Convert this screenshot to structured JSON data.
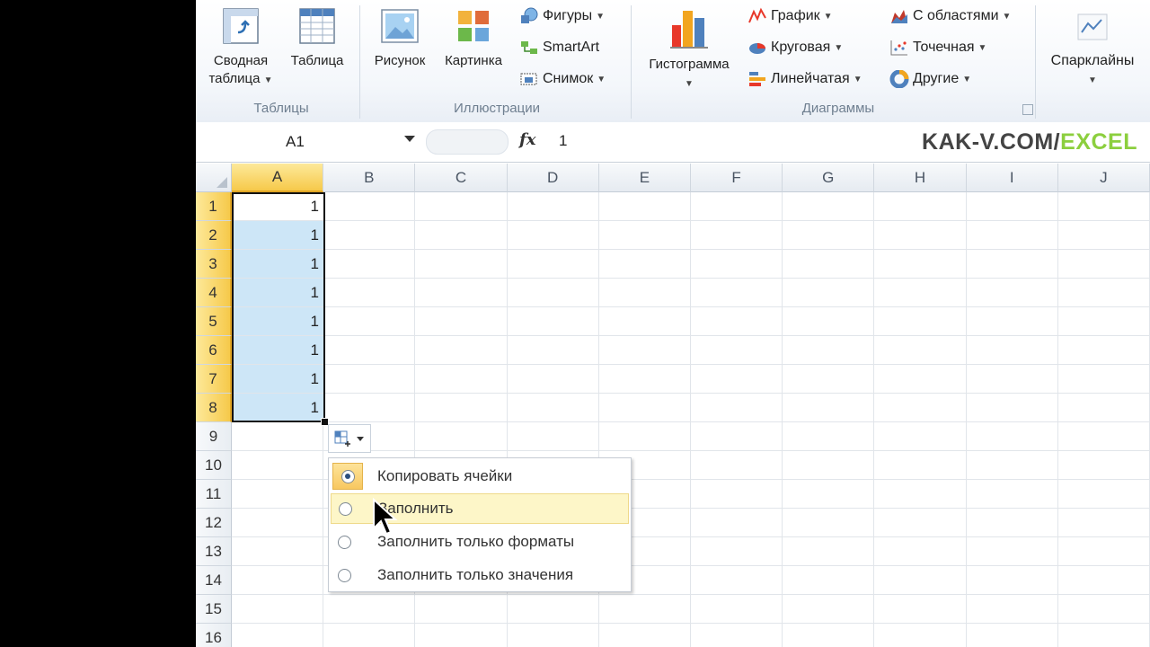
{
  "ribbon": {
    "groups": {
      "tables": "Таблицы",
      "illustrations": "Иллюстрации",
      "charts": "Диаграммы"
    },
    "pivot_line1": "Сводная",
    "pivot_line2": "таблица",
    "table": "Таблица",
    "picture": "Рисунок",
    "clipart": "Картинка",
    "shapes": "Фигуры",
    "smartart": "SmartArt",
    "screenshot": "Снимок",
    "histogram": "Гистограмма",
    "line_chart": "График",
    "pie_chart": "Круговая",
    "bar_chart": "Линейчатая",
    "area_chart": "С областями",
    "scatter_chart": "Точечная",
    "other_charts": "Другие",
    "sparklines": "Спарклайны"
  },
  "formula_bar": {
    "name_box": "A1",
    "fx": "fx",
    "value": "1"
  },
  "brand": {
    "part1": "KAK-V.COM/",
    "part2": "EXCEL"
  },
  "columns": [
    "A",
    "B",
    "C",
    "D",
    "E",
    "F",
    "G",
    "H",
    "I",
    "J"
  ],
  "rows": [
    "1",
    "2",
    "3",
    "4",
    "5",
    "6",
    "7",
    "8",
    "9",
    "10",
    "11",
    "12",
    "13",
    "14",
    "15",
    "16"
  ],
  "cells_a": [
    "1",
    "1",
    "1",
    "1",
    "1",
    "1",
    "1",
    "1"
  ],
  "autofill_menu": {
    "copy_cells": "Копировать ячейки",
    "fill_series": "Заполнить",
    "fill_formats": "Заполнить только форматы",
    "fill_values": "Заполнить только значения"
  },
  "colors": {
    "selection": "#cde6f7",
    "header_selected": "#f6c94a",
    "brand_green": "#8ccf3e"
  }
}
